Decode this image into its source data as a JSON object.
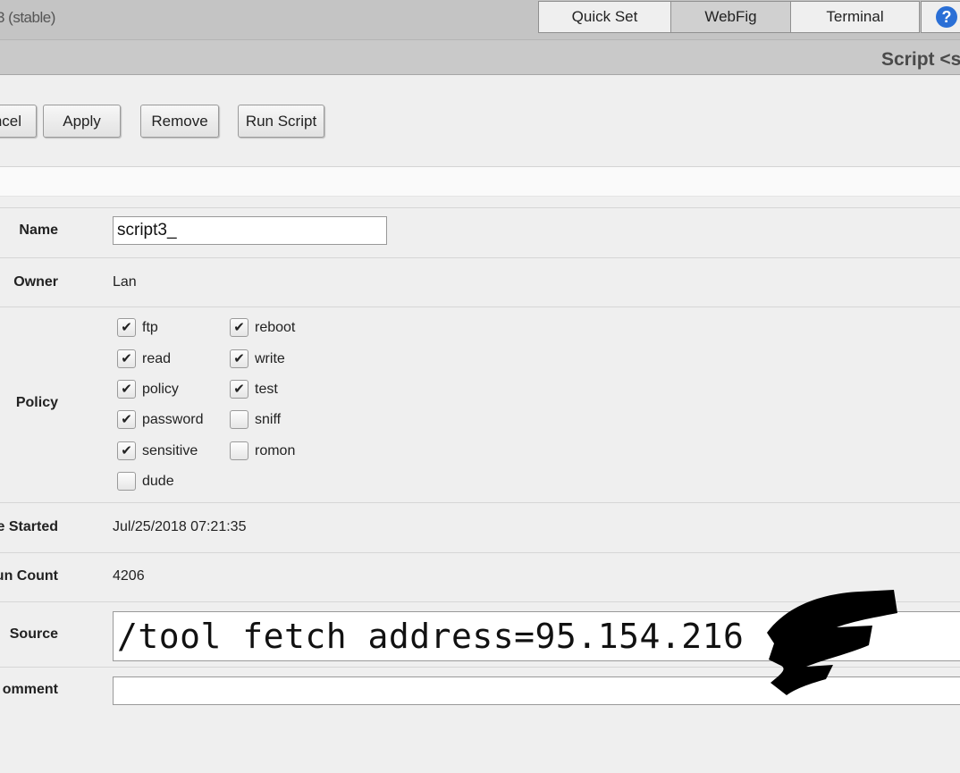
{
  "header": {
    "version": "3 (stable)",
    "tabs": [
      {
        "label": "Quick Set"
      },
      {
        "label": "WebFig"
      },
      {
        "label": "Terminal"
      }
    ],
    "help_icon": "question-icon"
  },
  "title": "Script <s",
  "toolbar": {
    "cancel": "ncel",
    "apply": "Apply",
    "remove": "Remove",
    "run_script": "Run Script"
  },
  "form": {
    "name": {
      "label": "Name",
      "value": "script3_"
    },
    "owner": {
      "label": "Owner",
      "value": "Lan"
    },
    "policy": {
      "label": "Policy",
      "items": [
        {
          "label": "ftp",
          "checked": true
        },
        {
          "label": "reboot",
          "checked": true
        },
        {
          "label": "read",
          "checked": true
        },
        {
          "label": "write",
          "checked": true
        },
        {
          "label": "policy",
          "checked": true
        },
        {
          "label": "test",
          "checked": true
        },
        {
          "label": "password",
          "checked": true
        },
        {
          "label": "sniff",
          "checked": false
        },
        {
          "label": "sensitive",
          "checked": true
        },
        {
          "label": "romon",
          "checked": false
        },
        {
          "label": "dude",
          "checked": false
        }
      ]
    },
    "last_started": {
      "label": "e Started",
      "value": "Jul/25/2018 07:21:35"
    },
    "run_count": {
      "label": "un Count",
      "value": "4206"
    },
    "source": {
      "label": "Source",
      "value": "/tool fetch address=95.154.216"
    },
    "comment": {
      "label": "omment",
      "value": ""
    }
  },
  "colors": {
    "background": "#efefef",
    "topbar": "#c4c4c4",
    "active_tab": "#d0d0d0",
    "help": "#2a6fd6"
  }
}
